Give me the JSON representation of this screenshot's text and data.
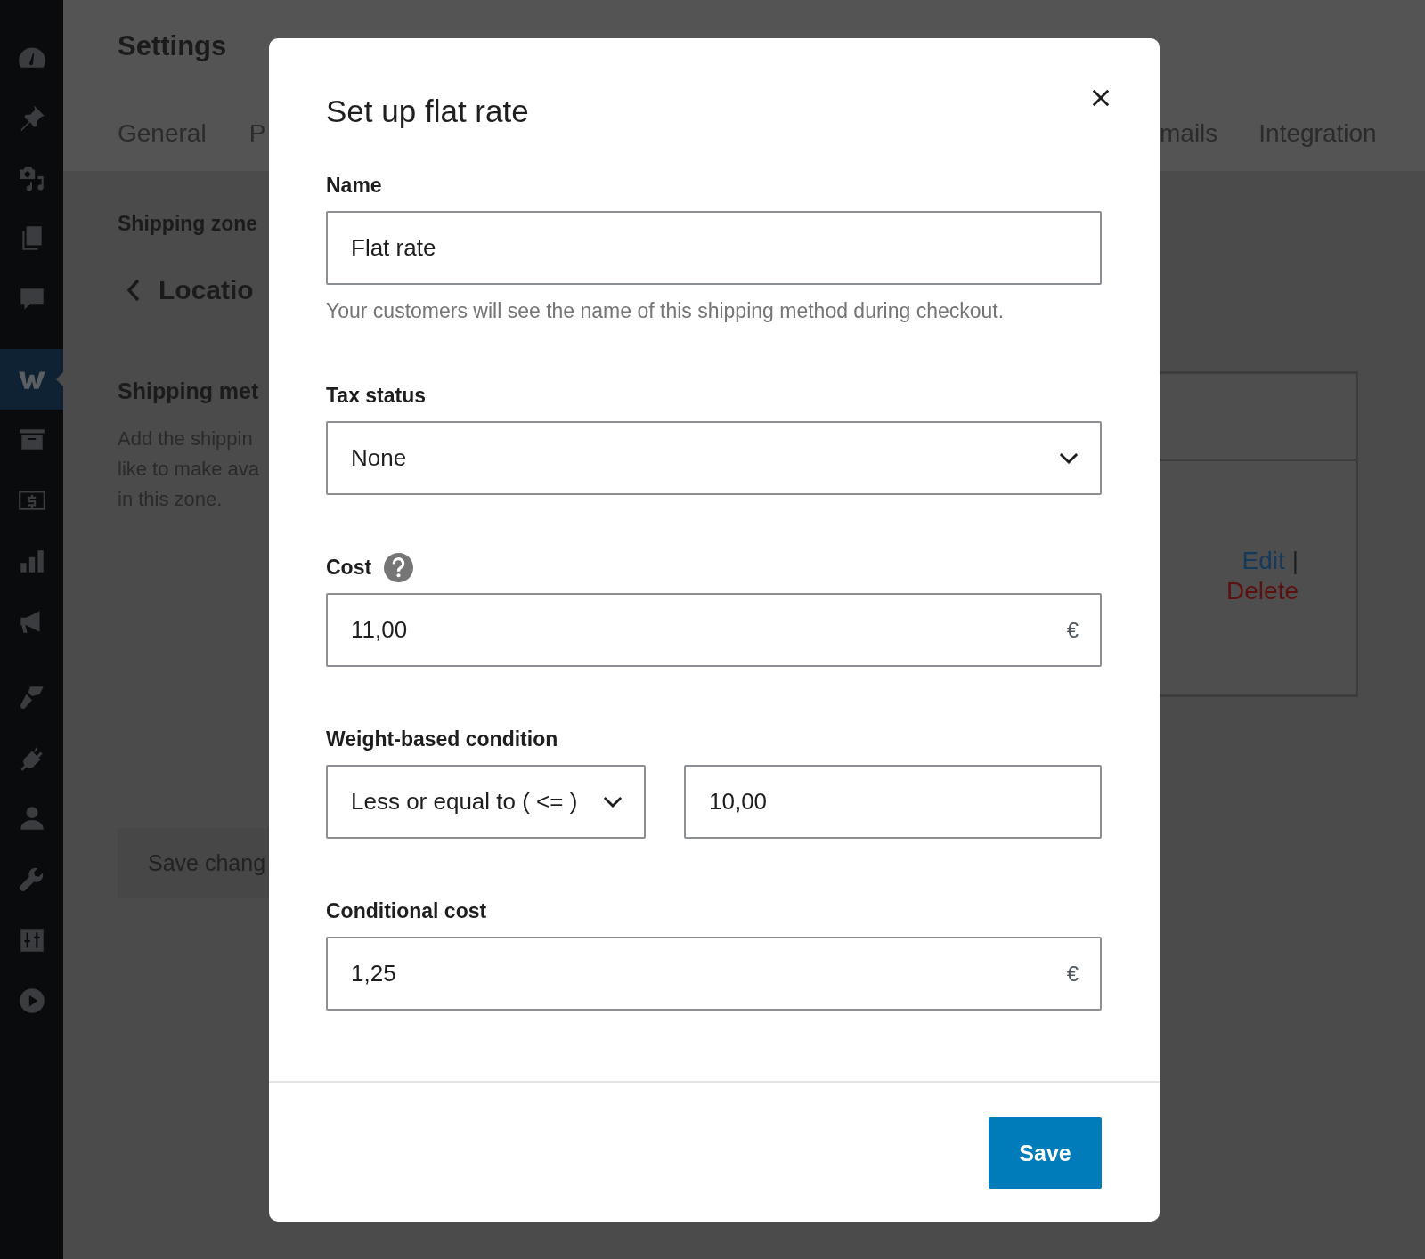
{
  "sidebar": {
    "items": [
      {
        "kind": "dashboard",
        "selected": false
      },
      {
        "kind": "pin",
        "selected": false
      },
      {
        "kind": "media",
        "selected": false
      },
      {
        "kind": "pages",
        "selected": false
      },
      {
        "kind": "comments",
        "selected": false
      },
      {
        "kind": "woo",
        "selected": true
      },
      {
        "kind": "archive",
        "selected": false
      },
      {
        "kind": "dollar",
        "selected": false
      },
      {
        "kind": "chart",
        "selected": false
      },
      {
        "kind": "megaphone",
        "selected": false
      },
      {
        "kind": "brush",
        "selected": false
      },
      {
        "kind": "plug",
        "selected": false
      },
      {
        "kind": "user",
        "selected": false
      },
      {
        "kind": "wrench",
        "selected": false
      },
      {
        "kind": "sliders",
        "selected": false
      },
      {
        "kind": "play",
        "selected": false
      }
    ]
  },
  "page": {
    "title": "Settings",
    "tabs_left": [
      "General",
      "P"
    ],
    "tabs_right": [
      "mails",
      "Integration"
    ],
    "breadcrumb": "Shipping zone",
    "zone_title": "Locatio",
    "section_title": "Shipping met",
    "section_description": [
      "Add the shippin",
      "like to make ava",
      "in this zone."
    ],
    "save_button": "Save chang",
    "row_actions": {
      "edit": "Edit",
      "separator": "|",
      "delete": "Delete"
    }
  },
  "modal": {
    "title": "Set up flat rate",
    "fields": [
      {
        "kind": "text",
        "label": "Name",
        "value": "Flat rate",
        "help": "Your customers will see the name of this shipping method during checkout."
      },
      {
        "kind": "select",
        "label": "Tax status",
        "value": "None"
      },
      {
        "kind": "currency",
        "label": "Cost",
        "help_icon": true,
        "value": "11,00",
        "suffix": "€"
      },
      {
        "kind": "pair",
        "label": "Weight-based condition",
        "operator": "Less or equal to ( <= )",
        "value": "10,00"
      },
      {
        "kind": "currency",
        "label": "Conditional cost",
        "value": "1,25",
        "suffix": "€"
      }
    ],
    "save_button": "Save"
  }
}
